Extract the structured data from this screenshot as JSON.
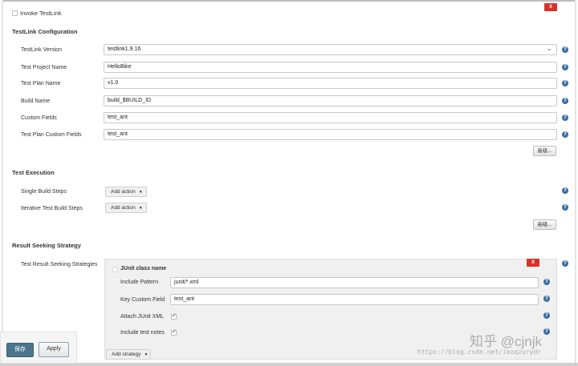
{
  "invoke": {
    "label": "Invoke TestLink",
    "delete": "X"
  },
  "config": {
    "title": "TestLink Configuration",
    "fields": {
      "version": {
        "label": "TestLink Version",
        "value": "testlink1.9.16"
      },
      "project": {
        "label": "Test Project Name",
        "value": "HelloBike"
      },
      "plan": {
        "label": "Test Plan Name",
        "value": "v1.0"
      },
      "build": {
        "label": "Build Name",
        "value": "build_$BUILD_ID"
      },
      "custom": {
        "label": "Custom Fields",
        "value": "test_ant"
      },
      "plan_custom": {
        "label": "Test Plan Custom Fields",
        "value": "test_ant"
      }
    },
    "advanced": "高级..."
  },
  "execution": {
    "title": "Test Execution",
    "single": "Single Build Steps",
    "iterative": "Iterative Test Build Steps",
    "add_action": "Add action",
    "advanced": "高级..."
  },
  "result": {
    "title": "Result Seeking Strategy",
    "label": "Test Result Seeking Strategies",
    "strategy": {
      "title": "JUnit class name",
      "delete": "X",
      "include_pattern": {
        "label": "Include Pattern",
        "value": "junit/*.xml"
      },
      "key_field": {
        "label": "Key Custom Field",
        "value": "test_ant"
      },
      "attach": {
        "label": "Attach JUnit XML",
        "checked": true
      },
      "notes": {
        "label": "Include test notes",
        "checked": true
      }
    },
    "add_strategy": "Add strategy"
  },
  "footer": {
    "save": "保存",
    "apply": "Apply"
  },
  "watermark": {
    "brand": "知乎 @cjnjk",
    "url": "https://blog.csdn.net/ikoqzurydr"
  },
  "help_glyph": "?",
  "colors": {
    "help": "#3a6ea5",
    "delete": "#d9312a",
    "save": "#4b758b"
  }
}
